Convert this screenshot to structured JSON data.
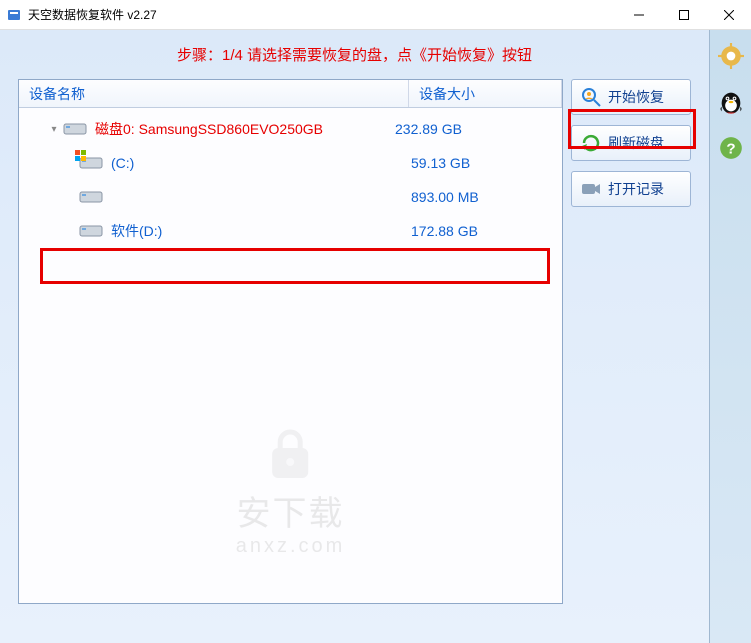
{
  "window": {
    "title": "天空数据恢复软件 v2.27"
  },
  "instruction": "步骤：1/4 请选择需要恢复的盘，点《开始恢复》按钮",
  "table": {
    "headers": {
      "name": "设备名称",
      "size": "设备大小"
    },
    "disk": {
      "label": "磁盘0: SamsungSSD860EVO250GB",
      "size": "232.89 GB"
    },
    "partitions": [
      {
        "label": "(C:)",
        "size": "59.13 GB",
        "osBadge": true
      },
      {
        "label": "",
        "size": "893.00 MB",
        "osBadge": false
      },
      {
        "label": "软件(D:)",
        "size": "172.88 GB",
        "osBadge": false
      }
    ]
  },
  "actions": {
    "start": "开始恢复",
    "refresh": "刷新磁盘",
    "openlog": "打开记录"
  },
  "watermark": {
    "text": "安下载",
    "url": "anxz.com"
  }
}
